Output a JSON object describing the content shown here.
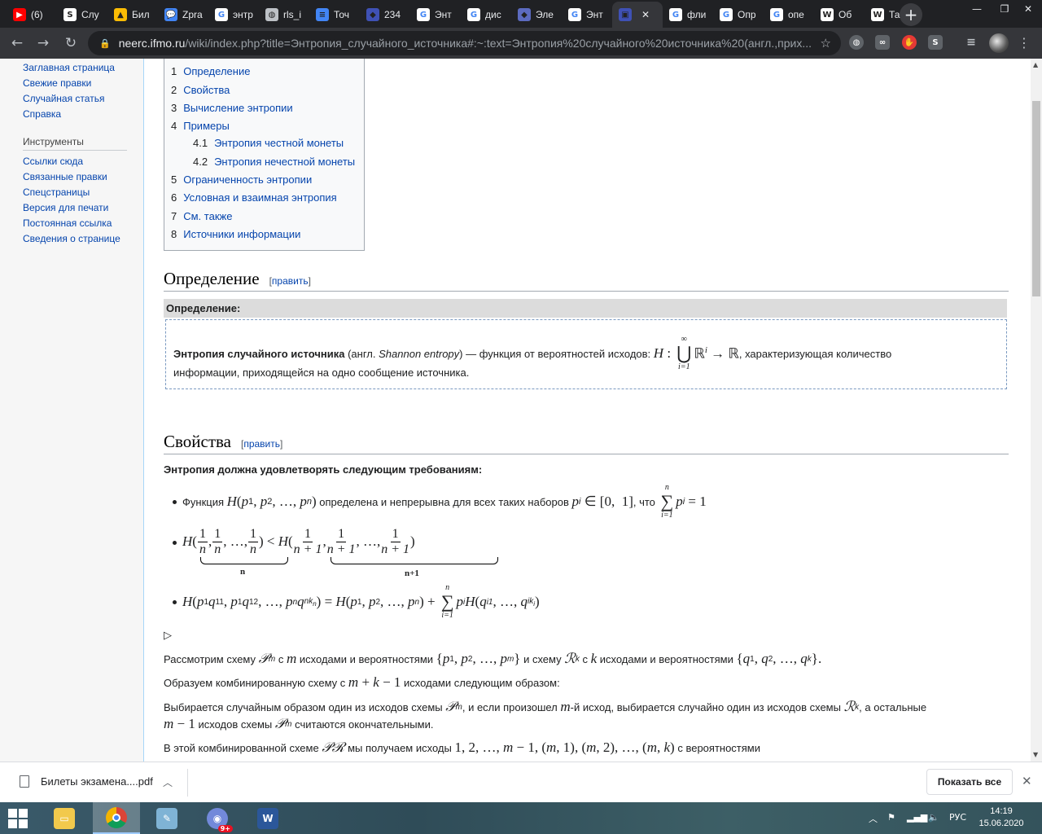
{
  "tabs": [
    {
      "label": "(6)",
      "icon": "youtube-icon",
      "color": "#ff0000"
    },
    {
      "label": "Слу",
      "icon": "scribd-icon",
      "color": "#ffffff"
    },
    {
      "label": "Бил",
      "icon": "google-drive-icon",
      "color": "#fbbc04"
    },
    {
      "label": "Zprа",
      "icon": "chat-icon",
      "color": "#4285f4"
    },
    {
      "label": "энтр",
      "icon": "google-icon",
      "color": "#ffffff"
    },
    {
      "label": "rls_i",
      "icon": "globe-icon",
      "color": "#bdc1c6"
    },
    {
      "label": "Точ",
      "icon": "google-docs-icon",
      "color": "#4285f4"
    },
    {
      "label": "234",
      "icon": "site-icon",
      "color": "#3f51b5"
    },
    {
      "label": "Энт",
      "icon": "google-icon",
      "color": "#ffffff"
    },
    {
      "label": "дис",
      "icon": "google-icon",
      "color": "#ffffff"
    },
    {
      "label": "Эле",
      "icon": "site-icon",
      "color": "#5c6bc0"
    },
    {
      "label": "Энт",
      "icon": "google-icon",
      "color": "#ffffff"
    },
    {
      "label": "",
      "icon": "neerc-icon",
      "color": "#3f51b5",
      "active": true
    },
    {
      "label": "фли",
      "icon": "google-icon",
      "color": "#ffffff"
    },
    {
      "label": "Опр",
      "icon": "google-icon",
      "color": "#ffffff"
    },
    {
      "label": "опе",
      "icon": "google-icon",
      "color": "#ffffff"
    },
    {
      "label": "Об",
      "icon": "wikipedia-icon",
      "color": "#ffffff"
    },
    {
      "label": "Таб",
      "icon": "wikipedia-icon",
      "color": "#ffffff"
    }
  ],
  "omnibox": {
    "host": "neerc.ifmo.ru",
    "path": "/wiki/index.php?title=Энтропия_случайного_источника#:~:text=Энтропия%20случайного%20источника%20(англ.,прих..."
  },
  "sidebar": {
    "nav": [
      "Заглавная страница",
      "Свежие правки",
      "Случайная статья",
      "Справка"
    ],
    "tools_heading": "Инструменты",
    "tools": [
      "Ссылки сюда",
      "Связанные правки",
      "Спецстраницы",
      "Версия для печати",
      "Постоянная ссылка",
      "Сведения о странице"
    ]
  },
  "toc": [
    {
      "num": "1",
      "text": "Определение",
      "level": 1
    },
    {
      "num": "2",
      "text": "Свойства",
      "level": 1
    },
    {
      "num": "3",
      "text": "Вычисление энтропии",
      "level": 1
    },
    {
      "num": "4",
      "text": "Примеры",
      "level": 1
    },
    {
      "num": "4.1",
      "text": "Энтропия честной монеты",
      "level": 2
    },
    {
      "num": "4.2",
      "text": "Энтропия нечестной монеты",
      "level": 2
    },
    {
      "num": "5",
      "text": "Ограниченность энтропии",
      "level": 1
    },
    {
      "num": "6",
      "text": "Условная и взаимная энтропия",
      "level": 1
    },
    {
      "num": "7",
      "text": "См. также",
      "level": 1
    },
    {
      "num": "8",
      "text": "Источники информации",
      "level": 1
    }
  ],
  "content": {
    "h_definition": "Определение",
    "edit": "править",
    "def_header": "Определение:",
    "def_term": "Энтропия случайного источника",
    "def_lang": "(англ.",
    "def_english": "Shannon entropy",
    "def_text1": ") — функция от вероятностей исходов:",
    "def_text2": ", характеризующая количество",
    "def_text3": "информации, приходящейся на одно сообщение источника.",
    "h_properties": "Свойства",
    "req_intro": "Энтропия должна удовлетворять следующим требованиям:",
    "bullet1_a": "Функция",
    "bullet1_b": "определена и непрерывна для всех таких наборов",
    "bullet1_c": ", что",
    "proof_marker": "▷",
    "p1_a": "Рассмотрим схему",
    "p1_b": "с",
    "p1_c": "исходами и вероятностями",
    "p1_d": "и схему",
    "p1_e": "с",
    "p1_f": "исходами и вероятностями",
    "p2_a": "Образуем комбинированную схему с",
    "p2_b": "исходами следующим образом:",
    "p3_a": "Выбирается случайным образом один из исходов схемы",
    "p3_b": ", и если произошел",
    "p3_c": "-й исход, выбирается случайно один из исходов схемы",
    "p3_d": ", а остальные",
    "p3_e": "исходов схемы",
    "p3_f": "считаются окончательными.",
    "p4_a": "В этой комбинированной схеме",
    "p4_b": "мы получаем исходы",
    "p4_c": "с вероятностями",
    "brace_n": "n",
    "brace_n1": "n+1"
  },
  "download": {
    "file": "Билеты экзамена....pdf",
    "show_all": "Показать все"
  },
  "taskbar": {
    "lang": "РУС",
    "time": "14:19",
    "date": "15.06.2020",
    "discord_badge": "9+"
  },
  "colors": {
    "link": "#0645ad",
    "tab_bg": "#202124",
    "toolbar": "#35363a"
  }
}
